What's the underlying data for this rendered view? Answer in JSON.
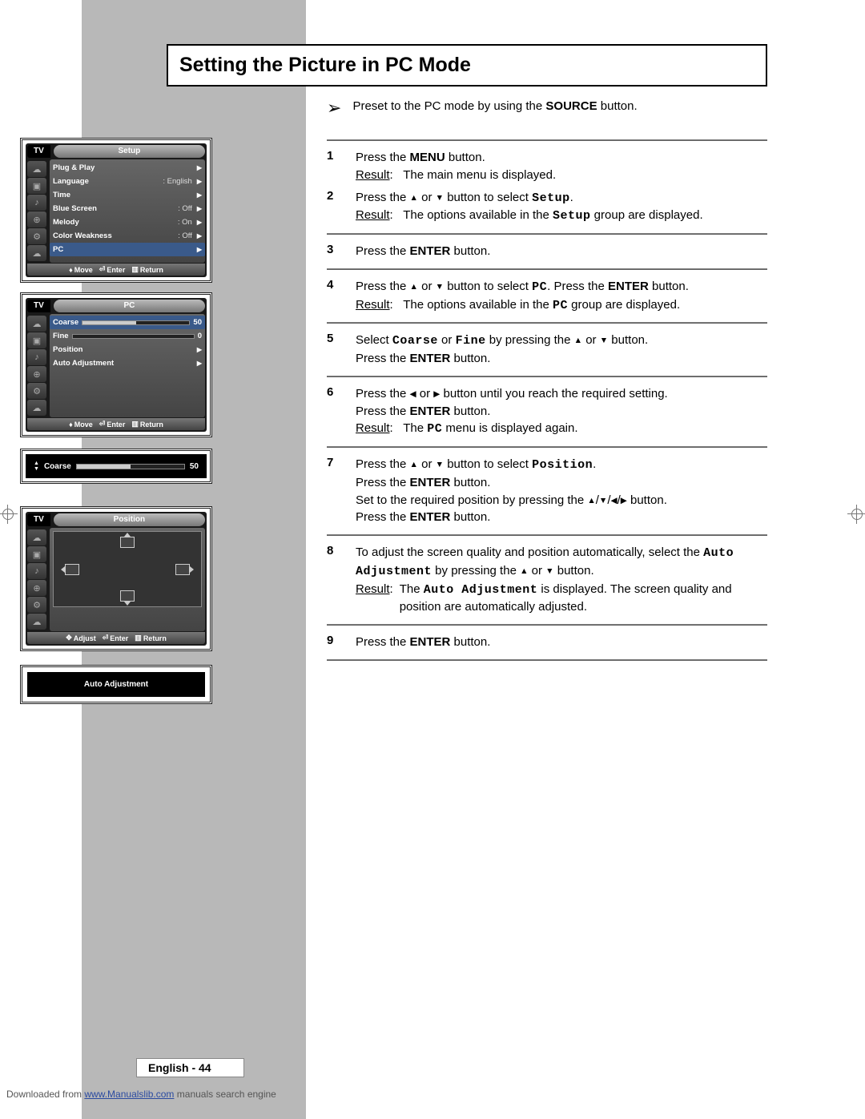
{
  "title": "Setting the Picture in PC Mode",
  "preset_pre": "Preset to the PC mode by using the ",
  "preset_bold": "SOURCE",
  "preset_post": " button.",
  "result_label": "Result",
  "steps": {
    "s1a_pre": "Press the ",
    "s1a_bold": "MENU",
    "s1a_post": " button.",
    "s1b": "The main menu is displayed.",
    "s2a_pre": "Press the ",
    "s2a_mid": " or ",
    "s2a_post": " button to select ",
    "s2a_mono": "Setup",
    "s2a_end": ".",
    "s2b_pre": "The options available in the ",
    "s2b_mono": "Setup",
    "s2b_post": " group are displayed.",
    "s3_pre": "Press the ",
    "s3_bold": "ENTER",
    "s3_post": " button.",
    "s4a_pre": "Press the ",
    "s4a_mid": " or ",
    "s4a_post": " button to select ",
    "s4a_mono": "PC",
    "s4a_after": ". Press the ",
    "s4a_bold": "ENTER",
    "s4a_end": " button.",
    "s4b_pre": "The options available in the ",
    "s4b_mono": "PC",
    "s4b_post": " group are displayed.",
    "s5a_pre": "Select ",
    "s5a_mono1": "Coarse",
    "s5a_or": " or ",
    "s5a_mono2": "Fine",
    "s5a_by": " by pressing the ",
    "s5a_mid": " or ",
    "s5a_end": " button.",
    "s5b_pre": "Press the ",
    "s5b_bold": "ENTER",
    "s5b_post": " button.",
    "s6a_pre": "Press the ",
    "s6a_mid": " or ",
    "s6a_post": " button until you reach the required setting.",
    "s6b_pre": "Press the ",
    "s6b_bold": "ENTER",
    "s6b_post": " button.",
    "s6c_pre": "The ",
    "s6c_mono": "PC",
    "s6c_post": " menu is displayed again.",
    "s7a_pre": "Press the ",
    "s7a_mid": " or ",
    "s7a_post": " button to select ",
    "s7a_mono": "Position",
    "s7a_end": ".",
    "s7b_pre": "Press the ",
    "s7b_bold": "ENTER",
    "s7b_post": " button.",
    "s7c_pre": "Set to the required position by pressing the ",
    "s7c_post": " button.",
    "s7d_pre": "Press the ",
    "s7d_bold": "ENTER",
    "s7d_post": " button.",
    "s8a_pre": "To adjust the screen quality and position automatically, select the ",
    "s8a_mono": "Auto Adjustment",
    "s8a_by": " by pressing the ",
    "s8a_mid": " or ",
    "s8a_end": " button.",
    "s8b_pre": "The ",
    "s8b_mono": "Auto Adjustment",
    "s8b_post": " is displayed. The screen quality and position are automatically adjusted.",
    "s9_pre": "Press the ",
    "s9_bold": "ENTER",
    "s9_post": " button."
  },
  "osd": {
    "tv": "TV",
    "setup": {
      "title": "Setup",
      "rows": [
        {
          "label": "Plug & Play",
          "val": "",
          "arrow": true
        },
        {
          "label": "Language",
          "val": ": English",
          "arrow": true
        },
        {
          "label": "Time",
          "val": "",
          "arrow": true
        },
        {
          "label": "Blue Screen",
          "val": ": Off",
          "arrow": true
        },
        {
          "label": "Melody",
          "val": ": On",
          "arrow": true
        },
        {
          "label": "Color Weakness",
          "val": ": Off",
          "arrow": true
        },
        {
          "label": "PC",
          "val": "",
          "arrow": true,
          "hl": true
        }
      ]
    },
    "pc": {
      "title": "PC",
      "coarse_label": "Coarse",
      "coarse_val": "50",
      "coarse_pct": 50,
      "fine_label": "Fine",
      "fine_val": "0",
      "fine_pct": 0,
      "position_label": "Position",
      "auto_label": "Auto Adjustment"
    },
    "mini": {
      "label": "Coarse",
      "val": "50"
    },
    "position": {
      "title": "Position"
    },
    "auto": {
      "label": "Auto Adjustment"
    },
    "footer": {
      "move": "Move",
      "adjust": "Adjust",
      "enter": "Enter",
      "ret": "Return"
    }
  },
  "footer": {
    "lang": "English - 44",
    "dl_pre": "Downloaded from ",
    "dl_link": "www.Manualslib.com",
    "dl_post": " manuals search engine"
  }
}
